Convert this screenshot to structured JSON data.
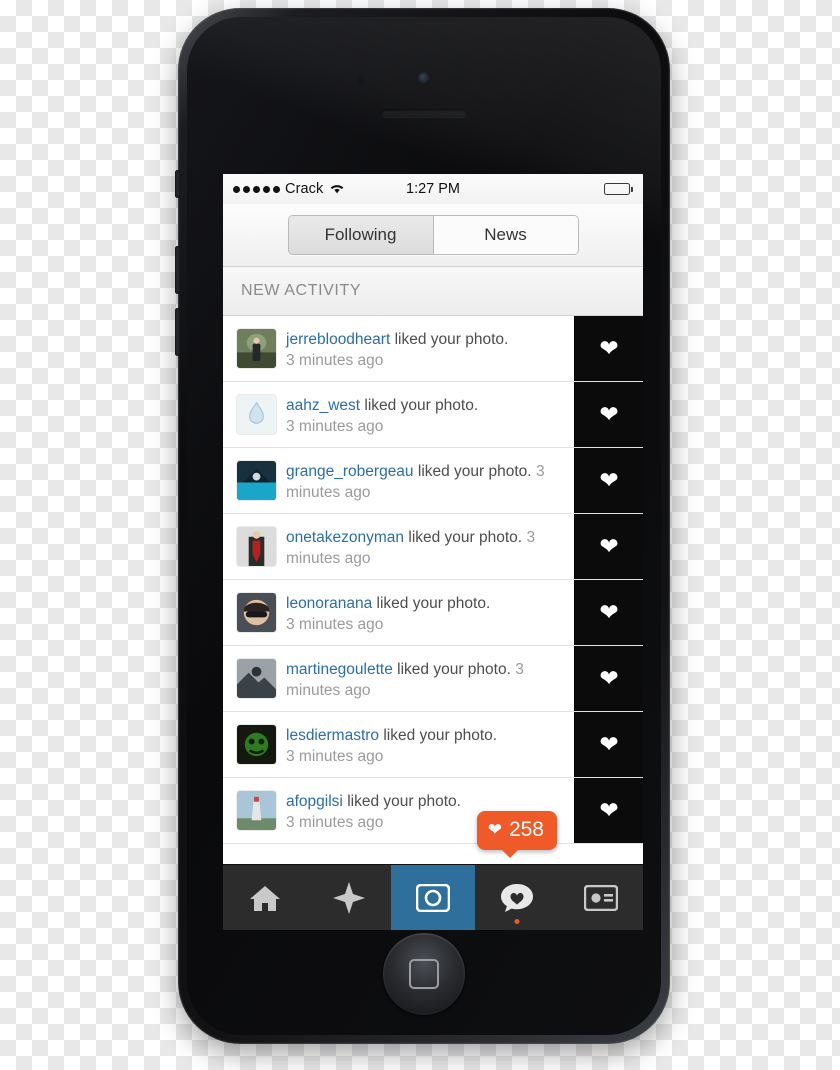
{
  "device": {
    "name": "iphone-mockup",
    "home_button": "home-button"
  },
  "status_bar": {
    "signal_dots": 5,
    "carrier": "Crack",
    "wifi_icon": "wifi-icon",
    "time": "1:27 PM",
    "battery_icon": "battery-icon"
  },
  "segmented_control": {
    "items": [
      {
        "label": "Following",
        "selected": true
      },
      {
        "label": "News",
        "selected": false
      }
    ]
  },
  "section": {
    "title": "NEW ACTIVITY"
  },
  "activity": {
    "action_text": "liked your photo.",
    "heart_icon": "heart-icon",
    "items": [
      {
        "username": "jerrebloodheart",
        "action": "liked your photo.",
        "time": "3 minutes ago"
      },
      {
        "username": "aahz_west",
        "action": "liked your photo.",
        "time": "3 minutes ago"
      },
      {
        "username": "grange_robergeau",
        "action": "liked your photo.",
        "time": "3 minutes ago"
      },
      {
        "username": "onetakezonyman",
        "action": "liked your photo.",
        "time": "3 minutes ago"
      },
      {
        "username": "leonoranana",
        "action": "liked your photo.",
        "time": "3 minutes ago"
      },
      {
        "username": "martinegoulette",
        "action": "liked your photo.",
        "time": "3 minutes ago"
      },
      {
        "username": "lesdiermastro",
        "action": "liked your photo.",
        "time": "3 minutes ago"
      },
      {
        "username": "afopgilsi",
        "action": "liked your photo.",
        "time": "3 minutes ago"
      }
    ]
  },
  "badge": {
    "count": "258",
    "icon": "heart-icon",
    "color": "#f05a28"
  },
  "tab_bar": {
    "accent_color": "#2e6f9b",
    "items": [
      {
        "name": "home-tab",
        "icon": "home-icon",
        "selected": false
      },
      {
        "name": "explore-tab",
        "icon": "compass-icon",
        "selected": false
      },
      {
        "name": "camera-tab",
        "icon": "camera-icon",
        "selected": true
      },
      {
        "name": "activity-tab",
        "icon": "heart-speech-icon",
        "selected": false,
        "has_dot": true
      },
      {
        "name": "profile-tab",
        "icon": "profile-card-icon",
        "selected": false
      }
    ]
  }
}
